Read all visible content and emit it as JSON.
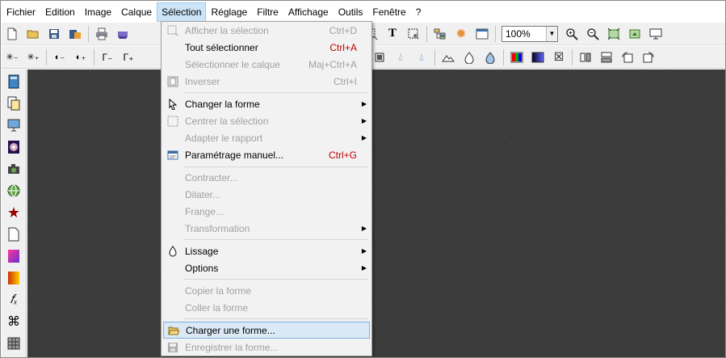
{
  "menubar": [
    "Fichier",
    "Edition",
    "Image",
    "Calque",
    "Sélection",
    "Réglage",
    "Filtre",
    "Affichage",
    "Outils",
    "Fenêtre",
    "?"
  ],
  "toolbar": {
    "zoom": "100%"
  },
  "menu": {
    "afficher": {
      "label": "Afficher la sélection",
      "shortcut": "Ctrl+D"
    },
    "tout": {
      "label": "Tout sélectionner",
      "shortcut": "Ctrl+A"
    },
    "calque": {
      "label": "Sélectionner le calque",
      "shortcut": "Maj+Ctrl+A"
    },
    "inverser": {
      "label": "Inverser",
      "shortcut": "Ctrl+I"
    },
    "changer": {
      "label": "Changer la forme"
    },
    "centrer": {
      "label": "Centrer la sélection"
    },
    "adapter": {
      "label": "Adapter le rapport"
    },
    "parametrage": {
      "label": "Paramétrage manuel...",
      "shortcut": "Ctrl+G"
    },
    "contracter": {
      "label": "Contracter..."
    },
    "dilater": {
      "label": "Dilater..."
    },
    "frange": {
      "label": "Frange..."
    },
    "transformation": {
      "label": "Transformation"
    },
    "lissage": {
      "label": "Lissage"
    },
    "options": {
      "label": "Options"
    },
    "copier": {
      "label": "Copier la forme"
    },
    "coller": {
      "label": "Coller la forme"
    },
    "charger": {
      "label": "Charger une forme..."
    },
    "enregistrer": {
      "label": "Enregistrer la forme..."
    }
  },
  "colors": {
    "menu_highlight": "#dbe9f6",
    "shortcut_red": "#c00000",
    "workspace": "#3b3b3b"
  }
}
